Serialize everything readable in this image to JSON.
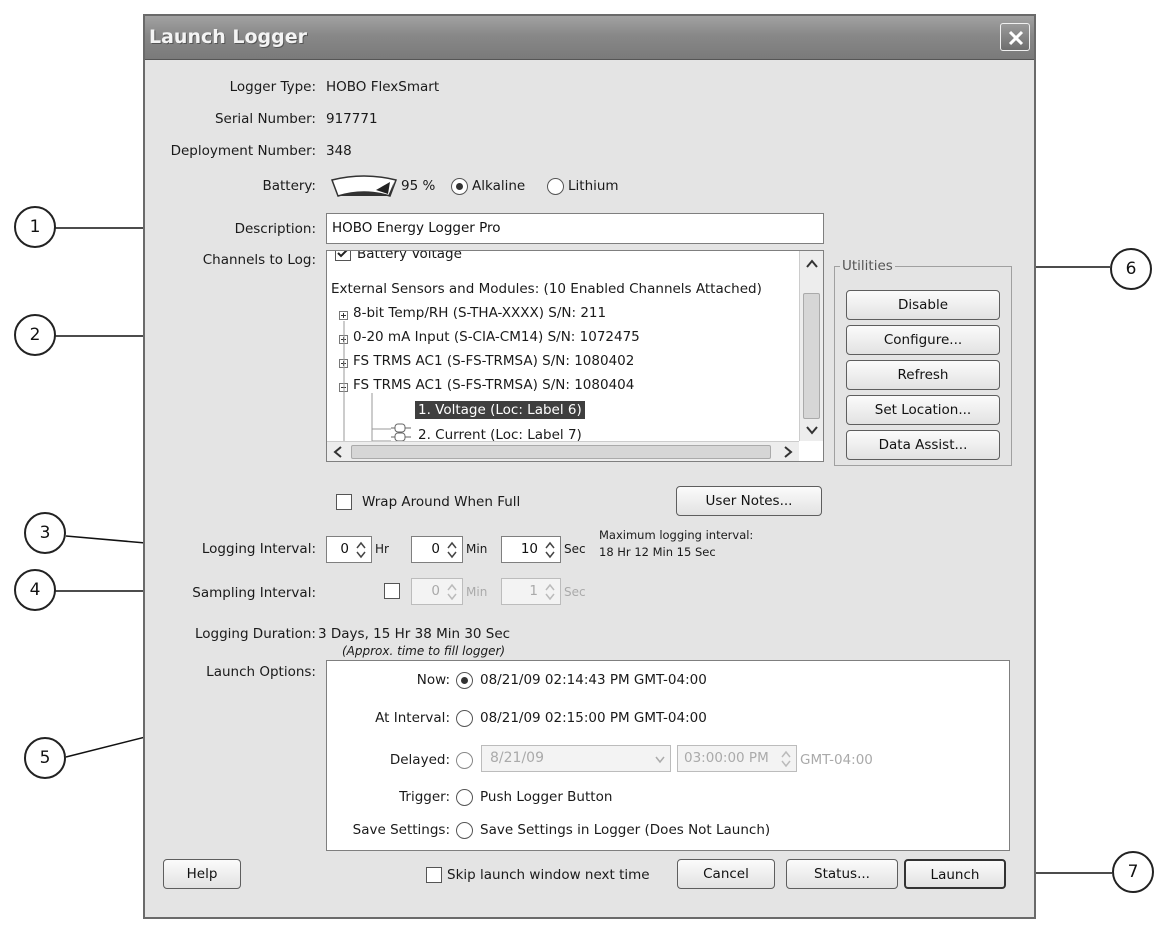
{
  "window": {
    "title": "Launch Logger"
  },
  "info": {
    "logger_type_label": "Logger Type:",
    "logger_type_value": "HOBO FlexSmart",
    "serial_label": "Serial Number:",
    "serial_value": "917771",
    "deployment_label": "Deployment Number:",
    "deployment_value": "348",
    "battery_label": "Battery:",
    "battery_percent": "95 %",
    "battery_level": 0.95,
    "battery_alkaline": "Alkaline",
    "battery_lithium": "Lithium",
    "description_label": "Description:",
    "description_value": "HOBO Energy Logger Pro"
  },
  "channels": {
    "label": "Channels to Log:",
    "battery_voltage": "Battery Voltage",
    "header": "External Sensors and Modules: (10 Enabled Channels Attached)",
    "items": [
      "8-bit Temp/RH (S-THA-XXXX) S/N: 211",
      "0-20 mA Input (S-CIA-CM14) S/N: 1072475",
      "FS TRMS AC1 (S-FS-TRMSA) S/N: 1080402",
      "FS TRMS AC1 (S-FS-TRMSA) S/N: 1080404"
    ],
    "subitems": [
      "1.  Voltage (Loc: Label 6)",
      "2.  Current (Loc: Label 7)"
    ]
  },
  "utilities": {
    "title": "Utilities",
    "disable": "Disable",
    "configure": "Configure...",
    "refresh": "Refresh",
    "set_location": "Set Location...",
    "data_assist": "Data Assist..."
  },
  "wrap_label": "Wrap Around When Full",
  "user_notes": "User Notes...",
  "logging": {
    "label": "Logging Interval:",
    "hr": "0",
    "hr_unit": "Hr",
    "min": "0",
    "min_unit": "Min",
    "sec": "10",
    "sec_unit": "Sec",
    "max_label": "Maximum logging interval:",
    "max_value": "18 Hr 12 Min 15 Sec"
  },
  "sampling": {
    "label": "Sampling Interval:",
    "min": "0",
    "min_unit": "Min",
    "sec": "1",
    "sec_unit": "Sec"
  },
  "duration": {
    "label": "Logging Duration:",
    "value": "3 Days, 15 Hr 38 Min 30 Sec",
    "note": "(Approx. time to fill logger)"
  },
  "launch_options": {
    "label": "Launch Options:",
    "now_label": "Now:",
    "now_value": "08/21/09 02:14:43 PM GMT-04:00",
    "interval_label": "At Interval:",
    "interval_value": "08/21/09 02:15:00 PM GMT-04:00",
    "delayed_label": "Delayed:",
    "delayed_date": "8/21/09",
    "delayed_time": "03:00:00 PM",
    "delayed_tz": "GMT-04:00",
    "trigger_label": "Trigger:",
    "trigger_value": "Push Logger Button",
    "save_label": "Save Settings:",
    "save_value": "Save Settings in Logger (Does Not Launch)"
  },
  "footer": {
    "help": "Help",
    "skip": "Skip launch window next time",
    "cancel": "Cancel",
    "status": "Status...",
    "launch": "Launch"
  },
  "callouts": [
    "1",
    "2",
    "3",
    "4",
    "5",
    "6",
    "7"
  ]
}
